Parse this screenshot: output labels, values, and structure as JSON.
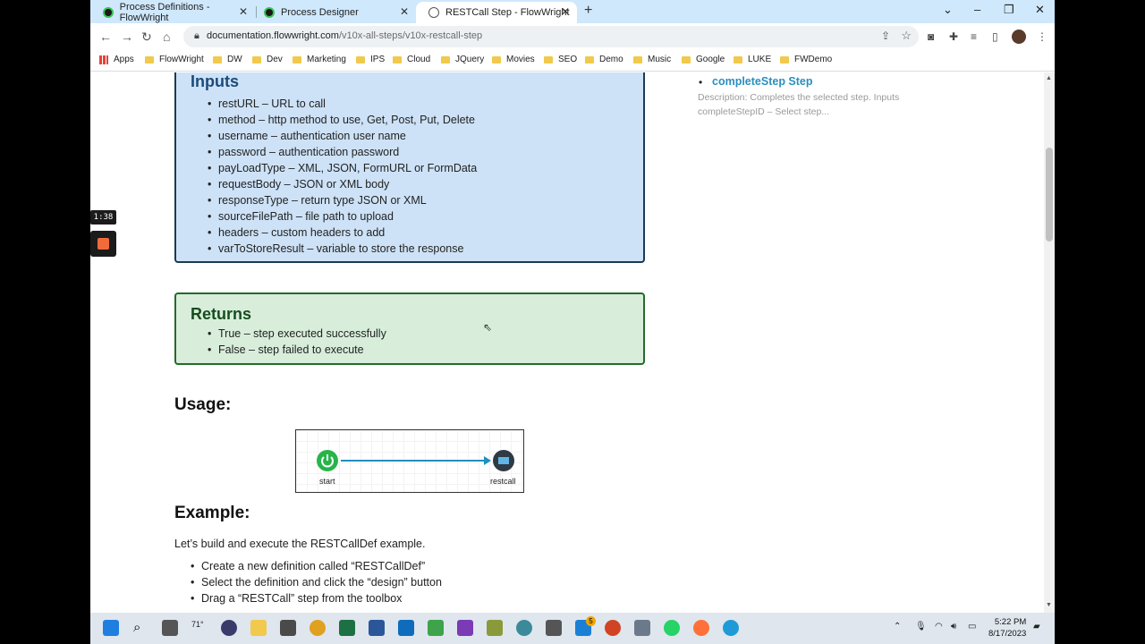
{
  "tabs": [
    {
      "title": "Process Definitions - FlowWright"
    },
    {
      "title": "Process Designer"
    },
    {
      "title": "RESTCall Step - FlowWright"
    }
  ],
  "address": {
    "host": "documentation.flowwright.com",
    "path": "/v10x-all-steps/v10x-restcall-step"
  },
  "bookmarks": [
    "Apps",
    "FlowWright",
    "DW",
    "Dev",
    "Marketing",
    "IPS",
    "Cloud",
    "JQuery",
    "Movies",
    "SEO",
    "Demo",
    "Music",
    "Google",
    "LUKE",
    "FWDemo"
  ],
  "inputs": {
    "title": "Inputs",
    "items": [
      "restURL – URL to call",
      "method – http method to use, Get, Post, Put, Delete",
      "username – authentication user name",
      "password – authentication password",
      "payLoadType – XML, JSON, FormURL or FormData",
      "requestBody – JSON or XML body",
      "responseType – return type JSON or XML",
      "sourceFilePath – file path to upload",
      "headers – custom headers to add",
      "varToStoreResult – variable to store the response"
    ]
  },
  "returns": {
    "title": "Returns",
    "items": [
      "True – step executed successfully",
      "False – step failed to execute"
    ]
  },
  "usage": {
    "heading": "Usage:",
    "start_label": "start",
    "end_label": "restcall"
  },
  "example": {
    "heading": "Example:",
    "intro": "Let’s build and execute the RESTCallDef example.",
    "steps": [
      "Create a new definition called “RESTCallDef”",
      "Select the definition and click the “design” button",
      "Drag a “RESTCall” step from the toolbox"
    ]
  },
  "sidebar": {
    "link": "completeStep Step",
    "desc_line1": "Description: Completes the selected step.     Inputs",
    "desc_line2": "completeStepID – Select step..."
  },
  "recorder": {
    "time": "1:38"
  },
  "taskbar": {
    "weather": "71°",
    "time": "5:22 PM",
    "date": "8/17/2023",
    "badge": "5"
  },
  "colors": {
    "inputs_bg": "#cde2f7",
    "returns_bg": "#d8eedb",
    "link": "#2a8fbd"
  }
}
